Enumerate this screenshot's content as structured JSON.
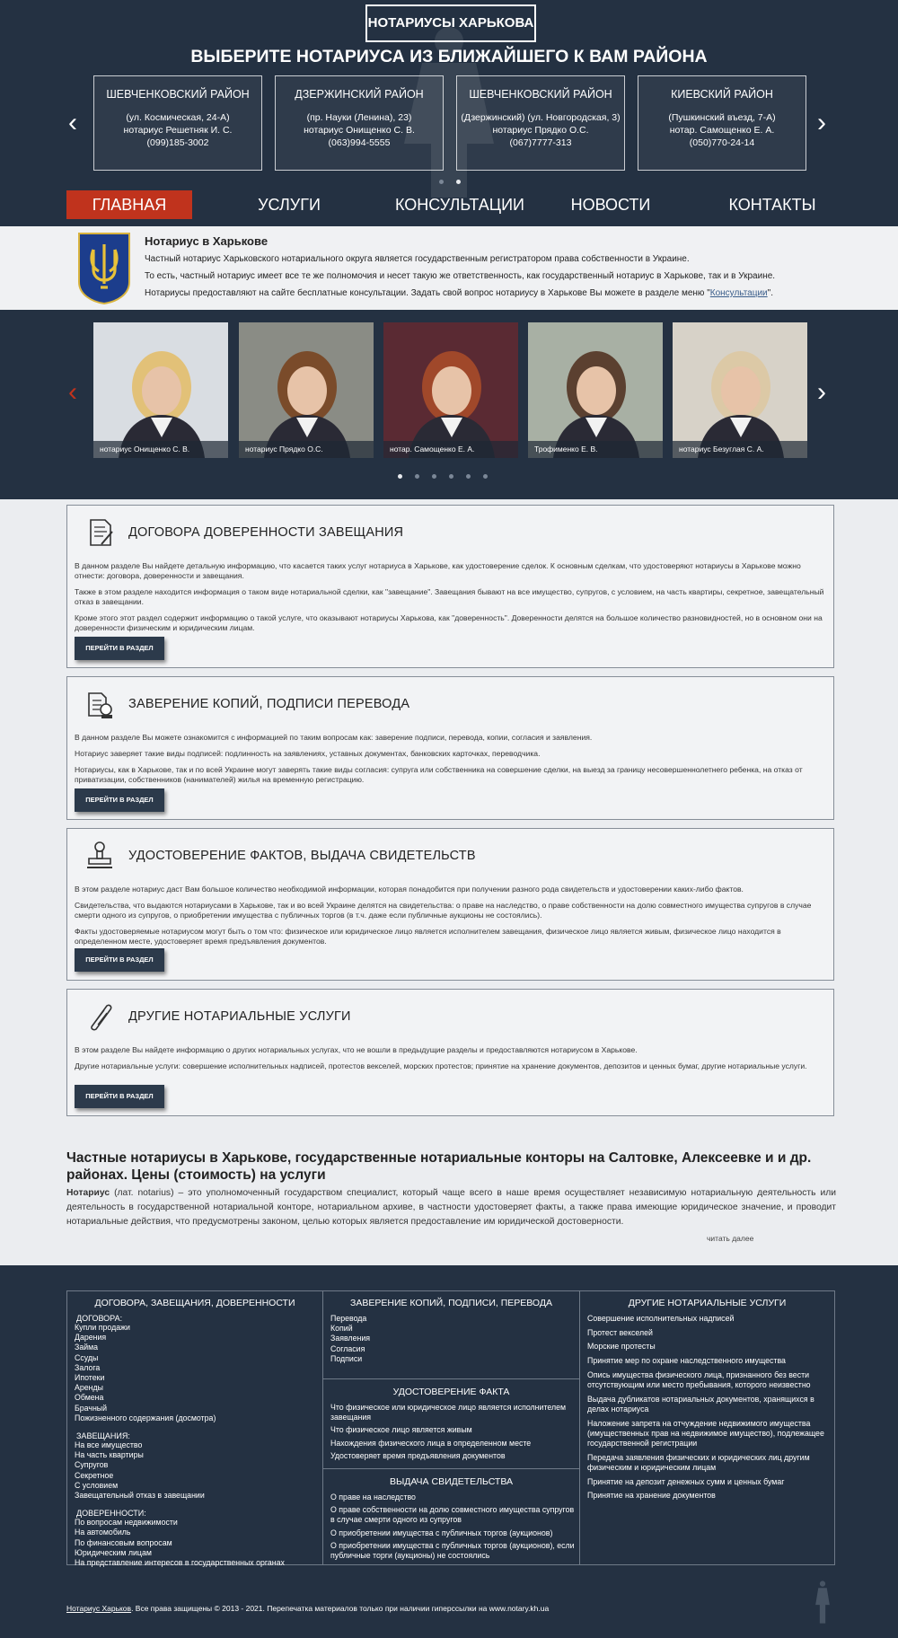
{
  "header": {
    "site_title": "НОТАРИУСЫ ХАРЬКОВА",
    "tagline": "ВЫБЕРИТЕ НОТАРИУСА ИЗ БЛИЖАЙШЕГО К ВАМ РАЙОНА",
    "districts": [
      {
        "title": "Шевченковский район",
        "line1": "(ул. Космическая, 24-А)",
        "line2": "нотариус Решетняк И. С.",
        "phone": "(099)185-3002"
      },
      {
        "title": "Дзержинский район",
        "line1": "(пр. Науки (Ленина), 23)",
        "line2": "нотариус Онищенко С. В.",
        "phone": "(063)994-5555"
      },
      {
        "title": "Шевченковский район",
        "line1": "(Дзержинский) (ул. Новгородская, 3)",
        "line2": "нотариус Прядко О.С.",
        "phone": "(067)7777-313"
      },
      {
        "title": "Киевский район",
        "line1": "(Пушкинский въезд, 7-А)",
        "line2": "нотар. Самощенко Е. А.",
        "phone": "(050)770-24-14"
      }
    ],
    "arrow_prev": "‹",
    "arrow_next": "›"
  },
  "nav": {
    "home": "Главная",
    "services": "Услуги",
    "consultations": "Консультации",
    "news": "Новости",
    "contacts": "Контакты"
  },
  "intro": {
    "title": "Нотариус в Харькове",
    "p1": "Частный нотариус Харьковского нотариального округа является государственным регистратором права собственности в Украине.",
    "p2": "То есть, частный нотариус имеет все те же полномочия и несет такую же ответственность, как государственный нотариус в Харькове, так и в Украине.",
    "p3_text": "Нотариусы предоставляют на сайте бесплатные консультации. Задать свой вопрос нотариусу в Харькове Вы можете в разделе меню \"",
    "p3_link": "Консультации",
    "p3_end": "\"."
  },
  "carousel": {
    "notaries": [
      {
        "caption": "нотариус Онищенко С. В.",
        "bg": "#d9dde2",
        "hair": "#e2c178"
      },
      {
        "caption": "нотариус Прядко О.С.",
        "bg": "#8a8c85",
        "hair": "#7a4b2a"
      },
      {
        "caption": "нотар. Самощенко Е. А.",
        "bg": "#5a2a33",
        "hair": "#a0482a"
      },
      {
        "caption": "Трофименко Е. В.",
        "bg": "#a8b0a4",
        "hair": "#5b4030"
      },
      {
        "caption": "нотариус Безуглая С. А.",
        "bg": "#d7d2c8",
        "hair": "#dcc9a6"
      }
    ],
    "arrow_prev": "‹",
    "arrow_next": "›"
  },
  "services": [
    {
      "title": "ДОГОВОРА ДОВЕРЕННОСТИ ЗАВЕЩАНИЯ",
      "icon": "contract-icon",
      "paragraphs": [
        "В данном разделе Вы найдете детальную информацию, что касается таких услуг нотариуса в Харькове, как удостоверение сделок. К основным сделкам, что удостоверяют нотариусы в Харькове можно отнести: договора, доверенности и завещания.",
        "Также в этом разделе находится информация о таком виде нотариальной сделки, как \"завещание\". Завещания бывают на все имущество, супругов, с условием, на часть квартиры, секретное, завещательный отказ в завещании.",
        "Кроме этого этот раздел содержит информацию о такой услуге, что оказывают нотариусы Харькова, как \"доверенность\". Доверенности делятся на большое количество разновидностей, но в основном они на доверенности физическим и юридическим лицам."
      ],
      "button": "ПЕРЕЙТИ В РАЗДЕЛ"
    },
    {
      "title": "ЗАВЕРЕНИЕ КОПИЙ, ПОДПИСИ ПЕРЕВОДА",
      "icon": "certified-copy-icon",
      "paragraphs": [
        "В данном разделе Вы можете ознакомится с информацией по таким вопросам как: заверение подписи, перевода, копии, согласия и заявления.",
        "Нотариус заверяет такие виды подписей: подлинность на заявлениях, уставных документах, банковских карточках, переводчика.",
        "Нотариусы, как в Харькове, так и по всей Украине могут заверять такие виды согласия: супруга или собственника на совершение сделки, на выезд за границу несовершеннолетнего ребенка, на отказ от приватизации, собственников (нанимателей) жилья на временную регистрацию."
      ],
      "button": "ПЕРЕЙТИ В РАЗДЕЛ"
    },
    {
      "title": "УДОСТОВЕРЕНИЕ ФАКТОВ, ВЫДАЧА СВИДЕТЕЛЬСТВ",
      "icon": "stamp-icon",
      "paragraphs": [
        "В этом разделе нотариус даст Вам большое количество необходимой информации, которая понадобится при получении разного рода свидетельств и удостоверении каких-либо фактов.",
        "Свидетельства, что выдаются нотариусами в Харькове, так и во всей Украине делятся на свидетельства: о праве на наследство, о праве собственности на долю совместного имущества супругов в случае смерти одного из супругов, о приобретении имущества с публичных торгов (в т.ч. даже если публичные аукционы не состоялись).",
        "Факты удостоверяемые нотариусом могут быть о том что: физическое или юридическое лицо является исполнителем завещания, физическое лицо является живым, физическое лицо находится в определенном месте, удостоверяет время предъявления документов."
      ],
      "button": "ПЕРЕЙТИ В РАЗДЕЛ"
    },
    {
      "title": "ДРУГИЕ НОТАРИАЛЬНЫЕ УСЛУГИ",
      "icon": "scroll-icon",
      "paragraphs": [
        "В этом разделе Вы найдете информацию о других нотариальных услугах, что не вошли в предыдущие разделы и предоставляются нотариусом в Харькове.",
        "Другие нотариальные услуги: совершение исполнительных надписей, протестов векселей, морских протестов; принятие на хранение документов, депозитов и ценных бумаг, другие нотариальные услуги."
      ],
      "button": "ПЕРЕЙТИ В РАЗДЕЛ"
    }
  ],
  "article": {
    "title": "Частные нотариусы в Харькове, государственные нотариальные конторы на Салтовке, Алексеевке и и др. районах. Цены (стоимость) на услуги",
    "term": "Нотариус",
    "body": " (лат. notarius) – это уполномоченный государством специалист, который чаще всего в наше время осуществляет независимую нотариальную деятельность или деятельность в государственной нотариальной конторе, нотариальном архиве, в частности удостоверяет факты, а также права имеющие юридическое значение, и проводит нотариальные действия, что предусмотрены законом, целью которых является предоставление им юридической достоверности.",
    "read_more": "читать далее"
  },
  "footer": {
    "col1": {
      "title": "ДОГОВОРА, ЗАВЕЩАНИЯ, ДОВЕРЕННОСТИ",
      "groups": [
        {
          "title": "ДОГОВОРА:",
          "items": [
            "Купли продажи",
            "Дарения",
            "Займа",
            "Ссуды",
            "Залога",
            "Ипотеки",
            "Аренды",
            "Обмена",
            "Брачный",
            "Пожизненного содержания (досмотра)"
          ]
        },
        {
          "title": "ЗАВЕЩАНИЯ:",
          "items": [
            "На все имущество",
            "На часть квартиры",
            "Супругов",
            "Секретное",
            "С условием",
            "Завещательный отказ в завещании"
          ]
        },
        {
          "title": "ДОВЕРЕННОСТИ:",
          "items": [
            "По вопросам недвижимости",
            "На автомобиль",
            "По финансовым вопросам",
            "Юридическим лицам",
            "На представление интересов в государственных органах"
          ]
        }
      ]
    },
    "col2": {
      "title": "ЗАВЕРЕНИЕ КОПИЙ, ПОДПИСИ, ПЕРЕВОДА",
      "items": [
        "Перевода",
        "Копий",
        "Заявления",
        "Согласия",
        "Подписи"
      ],
      "facts_title": "УДОСТОВЕРЕНИЕ ФАКТА",
      "facts": [
        "Что физическое или юридическое лицо является исполнителем завещания",
        "Что физическое лицо является живым",
        "Нахождения физического лица в определенном месте",
        "Удостоверяет время предъявления документов"
      ],
      "certs_title": "ВЫДАЧА СВИДЕТЕЛЬСТВА",
      "certs": [
        "О праве на наследство",
        "О праве собственности на долю совместного имущества супругов в случае смерти одного из супругов",
        "О приобретении имущества с публичных торгов (аукционов)",
        "О приобретении имущества с публичных торгов (аукционов), если публичные торги (аукционы) не состоялись"
      ]
    },
    "col3": {
      "title": "ДРУГИЕ НОТАРИАЛЬНЫЕ УСЛУГИ",
      "items": [
        "Совершение исполнительных надписей",
        "Протест векселей",
        "Морские протесты",
        "Принятие мер по охране наследственного имущества",
        "Опись имущества физического лица, признанного без вести отсутствующим или место пребывания, которого неизвестно",
        "Выдача дубликатов нотариальных документов, хранящихся в делах нотариуса",
        "Наложение запрета на отчуждение недвижимого имущества (имущественных прав на недвижимое имущество), подлежащее государственной регистрации",
        "Передача заявления физических и юридических лиц другим физическим и юридическим лицам",
        "Принятие на депозит денежных сумм и ценных бумаг",
        "Принятие на хранение документов"
      ]
    },
    "copyright_link": "Нотариус Харьков",
    "copyright_text": ". Все права защищены © 2013 - 2021. Перепечатка материалов только при наличии гиперссылки на www.notary.kh.ua"
  },
  "colors": {
    "header_bg": "#243142",
    "accent": "#c0331d",
    "body_bg": "#ebedf0"
  }
}
